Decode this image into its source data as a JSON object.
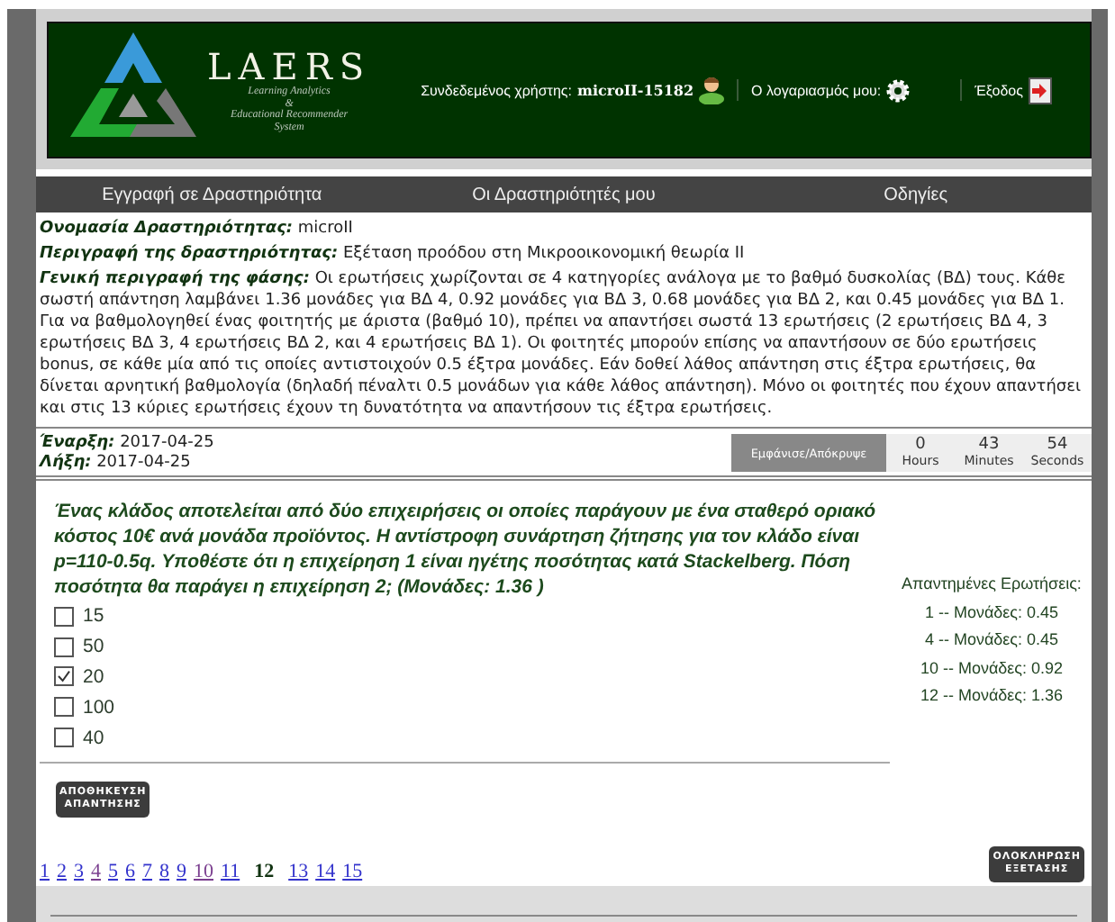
{
  "header": {
    "logo_title": "LAERS",
    "logo_subtitle": [
      "Learning Analytics",
      "&",
      "Educational Recommender",
      "System"
    ],
    "user_label": "Συνδεδεμένος χρήστης:",
    "user_name": "microII-15182",
    "account": "Ο λογαριασμός μου:",
    "logout": "Έξοδος"
  },
  "nav": [
    "Εγγραφή σε Δραστηριότητα",
    "Οι Δραστηριότητές μου",
    "Οδηγίες"
  ],
  "info": [
    {
      "label": "Ονομασία Δραστηριότητας:",
      "value": "microII"
    },
    {
      "label": "Περιγραφή της δραστηριότητας:",
      "value": "Εξέταση προόδου στη Μικροοικονομική θεωρία ΙΙ"
    },
    {
      "label": "Γενική περιγραφή της φάσης:",
      "value": "Οι ερωτήσεις χωρίζονται σε 4 κατηγορίες ανάλογα με το βαθμό δυσκολίας (ΒΔ) τους. Κάθε σωστή απάντηση λαμβάνει 1.36 μονάδες για ΒΔ 4, 0.92 μονάδες για ΒΔ 3, 0.68 μονάδες για ΒΔ 2, και 0.45 μονάδες για ΒΔ 1. Για να βαθμολογηθεί ένας φοιτητής με άριστα (βαθμό 10), πρέπει να απαντήσει σωστά 13 ερωτήσεις (2 ερωτήσεις ΒΔ 4, 3 ερωτήσεις ΒΔ 3, 4 ερωτήσεις ΒΔ 2, και 4 ερωτήσεις ΒΔ 1). Οι φοιτητές μπορούν επίσης να απαντήσουν σε δύο ερωτήσεις bonus, σε κάθε μία από τις οποίες αντιστοιχούν 0.5 έξτρα μονάδες. Εάν δοθεί λάθος απάντηση στις έξτρα ερωτήσεις, θα δίνεται αρνητική βαθμολογία (δηλαδή πέναλτι 0.5 μονάδων για κάθε λάθος απάντηση). Μόνο οι φοιτητές που έχουν απαντήσει και στις 13 κύριες ερωτήσεις έχουν τη δυνατότητα να απαντήσουν τις έξτρα ερωτήσεις."
    }
  ],
  "dates": [
    {
      "label": "Έναρξη:",
      "value": "2017-04-25"
    },
    {
      "label": "Λήξη:",
      "value": "2017-04-25"
    }
  ],
  "timer": {
    "toggle": "Εμφάνισε/Απόκρυψε",
    "units": [
      {
        "value": "0",
        "label": "Hours"
      },
      {
        "value": "43",
        "label": "Minutes"
      },
      {
        "value": "54",
        "label": "Seconds"
      }
    ]
  },
  "question": "Ένας κλάδος αποτελείται από δύο επιχειρήσεις οι οποίες παράγουν με ένα σταθερό οριακό κόστος 10€ ανά μονάδα προϊόντος. Η αντίστροφη συνάρτηση ζήτησης για τον κλάδο είναι p=110-0.5q. Υποθέστε ότι η επιχείρηση 1 είναι ηγέτης ποσότητας κατά Stackelberg. Πόση ποσότητα θα παράγει η επιχείρηση 2; (Μονάδες: 1.36 )",
  "options": [
    {
      "label": "15",
      "checked": false
    },
    {
      "label": "50",
      "checked": false
    },
    {
      "label": "20",
      "checked": true
    },
    {
      "label": "100",
      "checked": false
    },
    {
      "label": "40",
      "checked": false
    }
  ],
  "answered": {
    "title": "Απαντημένες Ερωτήσεις:",
    "items": [
      "1 -- Μονάδες: 0.45",
      "4 -- Μονάδες: 0.45",
      "10 -- Μονάδες: 0.92",
      "12 -- Μονάδες: 1.36"
    ]
  },
  "save_button": [
    "ΑΠΟΘΗΚΕΥΣΗ",
    "ΑΠΑΝΤΗΣΗΣ"
  ],
  "pages": [
    {
      "label": "1",
      "selected": false,
      "visited": false
    },
    {
      "label": "2",
      "selected": false,
      "visited": false
    },
    {
      "label": "3",
      "selected": false,
      "visited": false
    },
    {
      "label": "4",
      "selected": false,
      "visited": true
    },
    {
      "label": "5",
      "selected": false,
      "visited": false
    },
    {
      "label": "6",
      "selected": false,
      "visited": false
    },
    {
      "label": "7",
      "selected": false,
      "visited": false
    },
    {
      "label": "8",
      "selected": false,
      "visited": false
    },
    {
      "label": "9",
      "selected": false,
      "visited": false
    },
    {
      "label": "10",
      "selected": false,
      "visited": true
    },
    {
      "label": "11",
      "selected": false,
      "visited": false
    },
    {
      "label": "12",
      "selected": true,
      "visited": false
    },
    {
      "label": "13",
      "selected": false,
      "visited": false
    },
    {
      "label": "14",
      "selected": false,
      "visited": false
    },
    {
      "label": "15",
      "selected": false,
      "visited": false
    }
  ],
  "finish_button": [
    "ΟΛΟΚΛΗΡΩΣΗ",
    "ΕΞΕΤΑΣΗΣ"
  ]
}
